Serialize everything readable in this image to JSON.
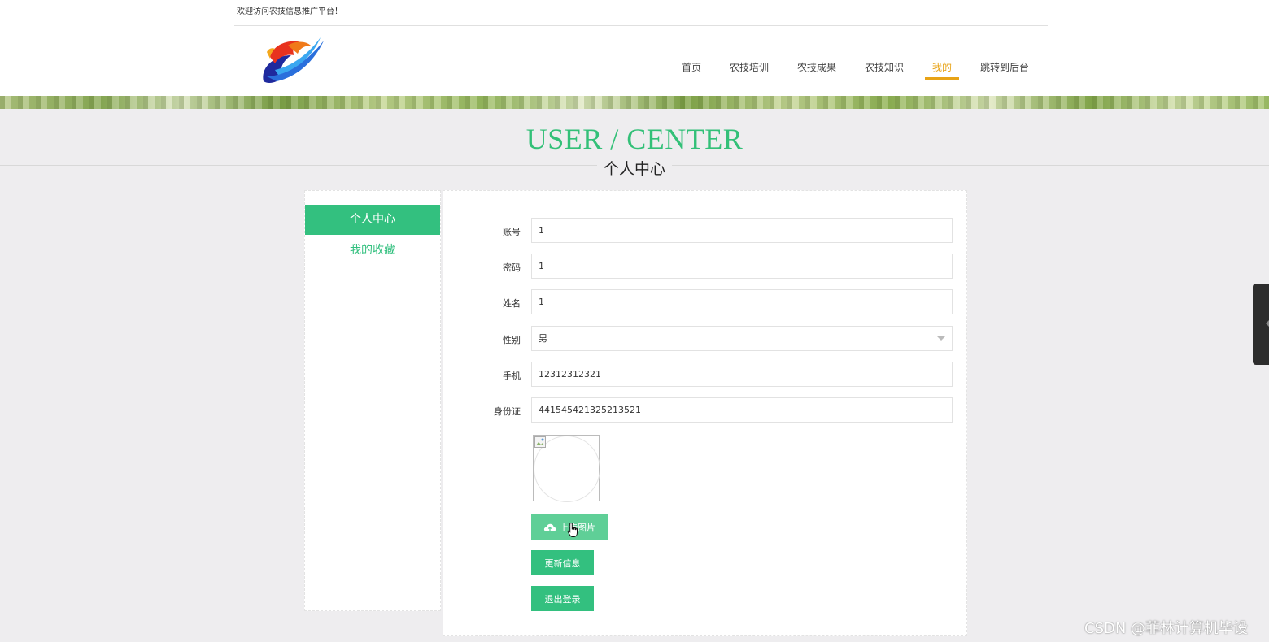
{
  "header": {
    "welcome": "欢迎访问农技信息推广平台！",
    "nav": [
      {
        "label": "首页"
      },
      {
        "label": "农技培训"
      },
      {
        "label": "农技成果"
      },
      {
        "label": "农技知识"
      },
      {
        "label": "我的"
      },
      {
        "label": "跳转到后台"
      }
    ],
    "active_nav": "我的"
  },
  "page_title": {
    "en": "USER / CENTER",
    "cn": "个人中心"
  },
  "sidebar": {
    "items": [
      {
        "label": "个人中心",
        "active": true
      },
      {
        "label": "我的收藏",
        "active": false
      }
    ]
  },
  "form": {
    "fields": [
      {
        "label": "账号",
        "value": "1"
      },
      {
        "label": "密码",
        "value": "1"
      },
      {
        "label": "姓名",
        "value": "1"
      },
      {
        "label": "性别",
        "value": "男"
      },
      {
        "label": "手机",
        "value": "12312312321"
      },
      {
        "label": "身份证",
        "value": "441545421325213521"
      }
    ],
    "upload_label": "上传图片",
    "update_label": "更新信息",
    "logout_label": "退出登录"
  },
  "watermark": "CSDN @菲林计算机毕设",
  "colors": {
    "accent_green": "#33c07f",
    "nav_active": "#e8a316"
  }
}
